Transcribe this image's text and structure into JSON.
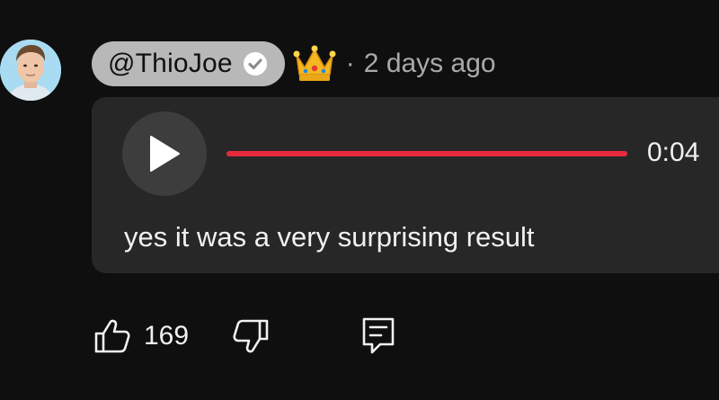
{
  "comment": {
    "author_handle": "@ThioJoe",
    "separator": "·",
    "timestamp": "2 days ago",
    "avatar_icon": "avatar-photo",
    "verified_icon": "verified-check-icon",
    "badge_icon": "crown-icon"
  },
  "voice_reply": {
    "duration": "0:04",
    "progress_fraction": 1.0,
    "transcript": "yes it was a very surprising result",
    "play_icon": "play-icon"
  },
  "actions": {
    "like_count": "169",
    "like_icon": "thumbs-up-icon",
    "dislike_icon": "thumbs-down-icon",
    "reply_icon": "reply-comment-icon"
  },
  "colors": {
    "background": "#0f0f0f",
    "card": "#272727",
    "progress": "#e62a3c",
    "pill": "#b8b8b8",
    "secondary_text": "#aaaaaa"
  }
}
